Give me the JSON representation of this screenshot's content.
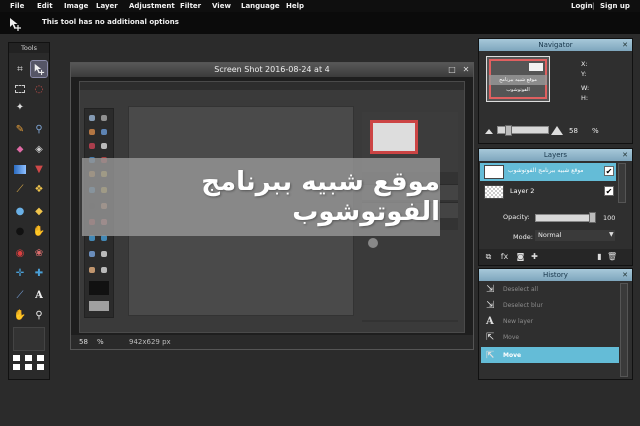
{
  "menu": {
    "items": [
      "File",
      "Edit",
      "Image",
      "Layer",
      "Adjustment",
      "Filter",
      "View",
      "Language",
      "Help"
    ],
    "login": "Login",
    "separator": "|",
    "signup": "Sign up"
  },
  "options_bar": {
    "message": "This tool has no additional options"
  },
  "tools_panel": {
    "title": "Tools"
  },
  "document": {
    "title": "Screen Shot 2016-08-24 at 4",
    "zoom_value": "58",
    "zoom_unit": "%",
    "dimensions": "942x629 px",
    "banner_text": "موقع شبيه ببرنامج الفوتوشوب"
  },
  "navigator": {
    "title": "Navigator",
    "x_label": "X:",
    "y_label": "Y:",
    "w_label": "W:",
    "h_label": "H:",
    "zoom_value": "58",
    "zoom_unit": "%",
    "thumb_text": "موقع شبيه ببرنامج الفوتوشوب"
  },
  "layers": {
    "title": "Layers",
    "items": [
      {
        "name": "موقع شبيه ببرنامج الفوتوشوب",
        "visible": true,
        "selected": true
      },
      {
        "name": "Layer 2",
        "visible": true,
        "selected": false
      }
    ],
    "opacity_label": "Opacity:",
    "opacity_value": "100",
    "mode_label": "Mode:",
    "mode_value": "Normal"
  },
  "history": {
    "title": "History",
    "items": [
      {
        "label": "Deselect all",
        "icon": "cursor-icon",
        "active": false
      },
      {
        "label": "Deselect blur",
        "icon": "cursor-icon",
        "active": false
      },
      {
        "label": "New layer",
        "icon": "text-icon",
        "active": false
      },
      {
        "label": "Move",
        "icon": "move-icon",
        "active": false
      },
      {
        "label": "Move",
        "icon": "move-icon",
        "active": true
      }
    ]
  },
  "colors": {
    "accent": "#64bcd7",
    "panel_header": "#a7c8d9",
    "menubar": "#0f0f0f"
  }
}
